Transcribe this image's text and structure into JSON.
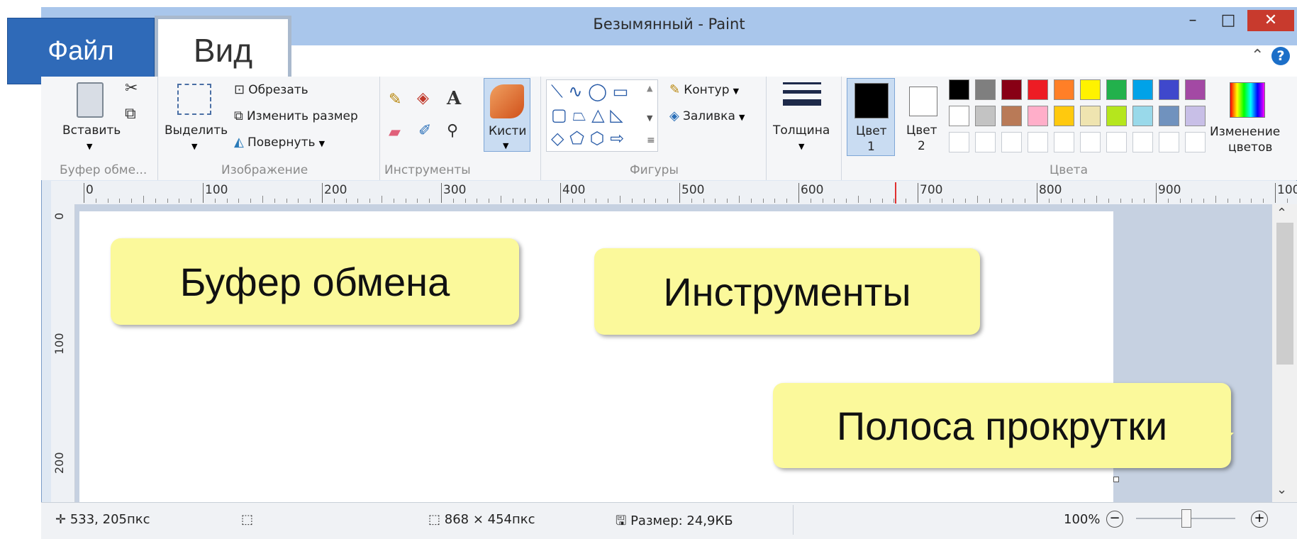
{
  "window": {
    "title": "Безымянный - Paint",
    "min_icon": "–",
    "max_icon": "□",
    "close_icon": "✕"
  },
  "tabs": {
    "file": "Файл",
    "view": "Вид"
  },
  "ribbon": {
    "clipboard": {
      "paste": "Вставить",
      "group": "Буфер обме..."
    },
    "image": {
      "select": "Выделить",
      "crop": "Обрезать",
      "resize": "Изменить размер",
      "rotate": "Повернуть",
      "group": "Изображение"
    },
    "tools": {
      "group": "Инструменты"
    },
    "brushes": {
      "label": "Кисти"
    },
    "shapes": {
      "outline": "Контур",
      "fill": "Заливка",
      "group": "Фигуры"
    },
    "size": {
      "label": "Толщина"
    },
    "color1": {
      "label": "Цвет",
      "num": "1"
    },
    "color2": {
      "label": "Цвет",
      "num": "2"
    },
    "colors": {
      "group": "Цвета",
      "edit_line1": "Изменение",
      "edit_line2": "цветов",
      "row1": [
        "#000000",
        "#7f7f7f",
        "#880015",
        "#ed1c24",
        "#ff7f27",
        "#fff200",
        "#22b14c",
        "#00a2e8",
        "#3f48cc",
        "#a349a4"
      ],
      "row2": [
        "#ffffff",
        "#c3c3c3",
        "#b97a57",
        "#ffaec9",
        "#ffc90e",
        "#efe4b0",
        "#b5e61d",
        "#99d9ea",
        "#7092be",
        "#c8bfe7"
      ]
    }
  },
  "ruler": {
    "h": [
      "0",
      "100",
      "200",
      "300",
      "400",
      "500",
      "600",
      "700",
      "800",
      "900",
      "100"
    ],
    "v": [
      "0",
      "100",
      "200"
    ]
  },
  "callouts": {
    "clipboard": "Буфер обмена",
    "tools": "Инструменты",
    "scrollbar": "Полоса прокрутки"
  },
  "status": {
    "cursor": "533, 205пкс",
    "image_size": "868 × 454пкс",
    "file_size": "Размер: 24,9КБ",
    "zoom": "100%"
  }
}
